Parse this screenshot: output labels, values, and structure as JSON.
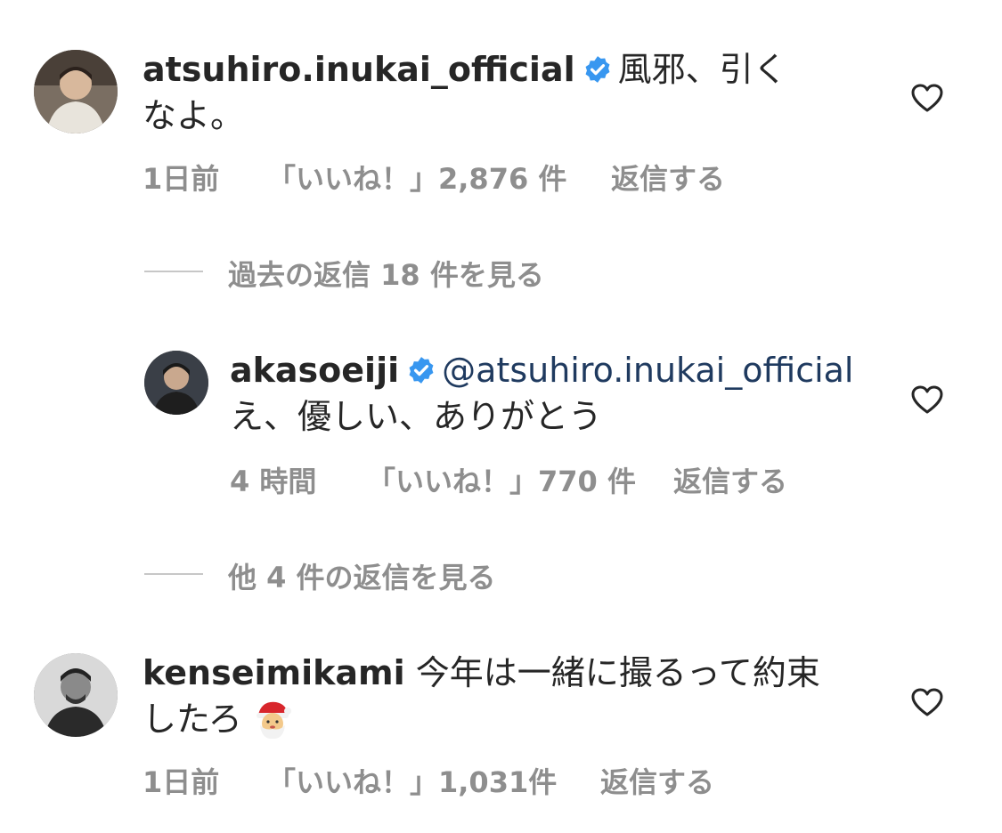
{
  "comments": [
    {
      "username": "atsuhiro.inukai_official",
      "verified": true,
      "text": "風邪、引くなよ。",
      "time": "1日前",
      "likes": "「いいね！」2,876 件",
      "reply": "返信する"
    },
    {
      "username": "kenseimikami",
      "verified": false,
      "text": "今年は一緒に撮るって約束したろ",
      "time": "1日前",
      "likes": "「いいね！」1,031件",
      "reply": "返信する"
    }
  ],
  "reply": {
    "username": "akasoeiji",
    "verified": true,
    "mention": "@atsuhiro.inukai_official",
    "text": "え、優しい、ありがとう",
    "time": "4 時間",
    "likes": "「いいね！」770 件",
    "reply": "返信する"
  },
  "view_previous": "過去の返信 18 件を見る",
  "view_more": "他 4 件の返信を見る",
  "icons": {
    "like": "heart-outline-icon",
    "verified": "verified-badge-icon",
    "emoji": "santa-emoji"
  },
  "colors": {
    "verified": "#3897f0",
    "meta": "#8e8e8e",
    "mention": "#1f3a5f",
    "divider": "#c7c7c7"
  }
}
